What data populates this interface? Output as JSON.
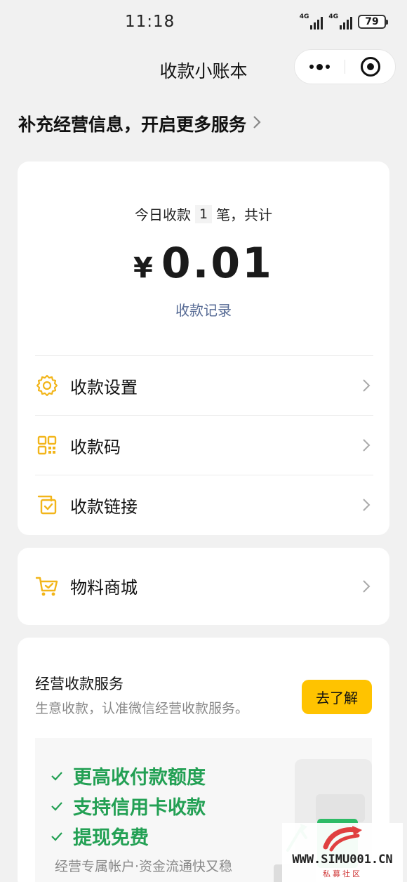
{
  "status_bar": {
    "time": "11:18",
    "signal1": "4G",
    "signal2": "4G",
    "battery": "79"
  },
  "nav": {
    "title": "收款小账本"
  },
  "promo": {
    "text": "补充经营信息，开启更多服务"
  },
  "summary": {
    "prefix": "今日收款",
    "count": "1",
    "suffix": "笔，共计",
    "currency": "¥",
    "amount": "0.01",
    "record_link": "收款记录"
  },
  "menu": [
    {
      "label": "收款设置",
      "icon": "gear-icon"
    },
    {
      "label": "收款码",
      "icon": "qr-code-icon"
    },
    {
      "label": "收款链接",
      "icon": "link-card-icon"
    }
  ],
  "shop": {
    "label": "物料商城",
    "icon": "cart-icon"
  },
  "service": {
    "title": "经营收款服务",
    "subtitle": "生意收款，认准微信经营收款服务。",
    "button": "去了解",
    "benefits": [
      "更高收付款额度",
      "支持信用卡收款",
      "提现免费"
    ],
    "footer": "经营专属帐户·资金流通快又稳"
  },
  "watermark": {
    "text": "WWW.SIMU001.CN",
    "sub": "私募社区"
  },
  "colors": {
    "accent_yellow": "#ffc300",
    "link_blue": "#576b95",
    "benefit_green": "#23a054",
    "icon_yellow": "#f2b51a"
  }
}
